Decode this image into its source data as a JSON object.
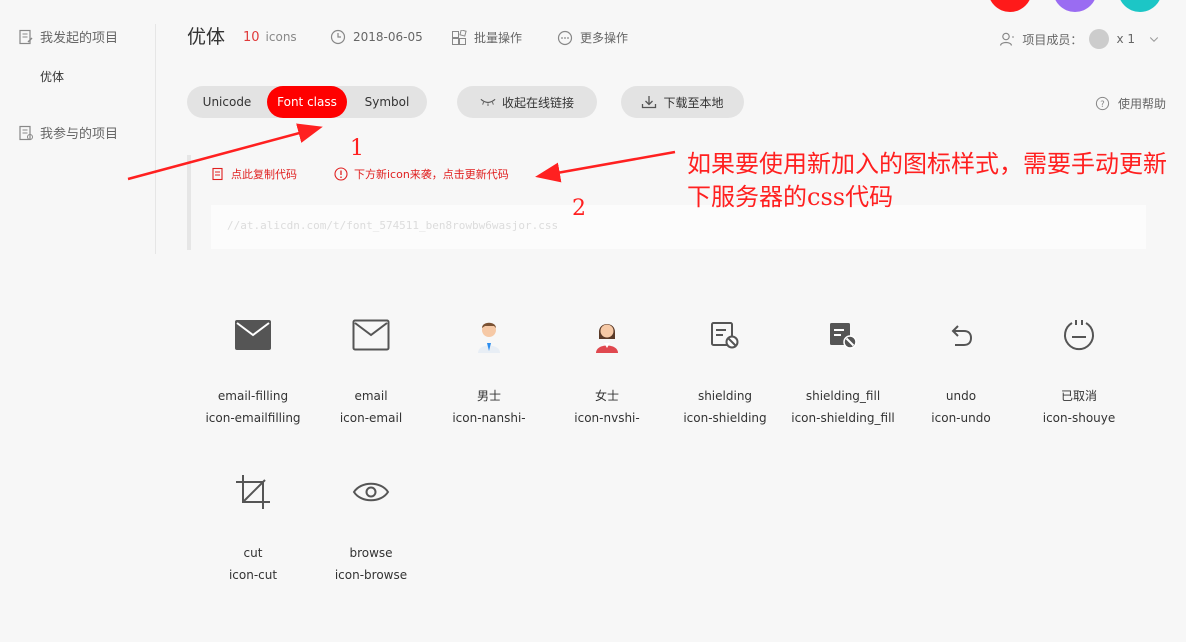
{
  "sidebar": {
    "my_projects": "我发起的项目",
    "sub_item": "优体",
    "joined_projects": "我参与的项目"
  },
  "header": {
    "title": "优体",
    "count": "10",
    "count_unit": "icons",
    "date": "2018-06-05",
    "batch": "批量操作",
    "more": "更多操作",
    "members_label": "项目成员：",
    "members_count": "x 1"
  },
  "tabs": {
    "unicode": "Unicode",
    "font_class": "Font class",
    "symbol": "Symbol",
    "collapse_link": "收起在线链接",
    "download": "下载至本地",
    "help": "使用帮助"
  },
  "code": {
    "copy": "点此复制代码",
    "update_notice": "下方新icon来袭，点击更新代码",
    "url": "//at.alicdn.com/t/font_574511_ben8rowbw6wasjor.css"
  },
  "annotations": {
    "num1": "1",
    "num2": "2",
    "text": "如果要使用新加入的图标样式，需要手动更新下服务器的css代码"
  },
  "icons": [
    {
      "name": "email-filling",
      "cls": "icon-emailfilling"
    },
    {
      "name": "email",
      "cls": "icon-email"
    },
    {
      "name": "男士",
      "cls": "icon-nanshi-"
    },
    {
      "name": "女士",
      "cls": "icon-nvshi-"
    },
    {
      "name": "shielding",
      "cls": "icon-shielding"
    },
    {
      "name": "shielding_fill",
      "cls": "icon-shielding_fill"
    },
    {
      "name": "undo",
      "cls": "icon-undo"
    },
    {
      "name": "已取消",
      "cls": "icon-shouye"
    },
    {
      "name": "cut",
      "cls": "icon-cut"
    },
    {
      "name": "browse",
      "cls": "icon-browse"
    }
  ],
  "colors": {
    "accent": "#ff0000",
    "dot1": "#ff1a1a",
    "dot2": "#9a6cf2",
    "dot3": "#1cc6c6"
  }
}
